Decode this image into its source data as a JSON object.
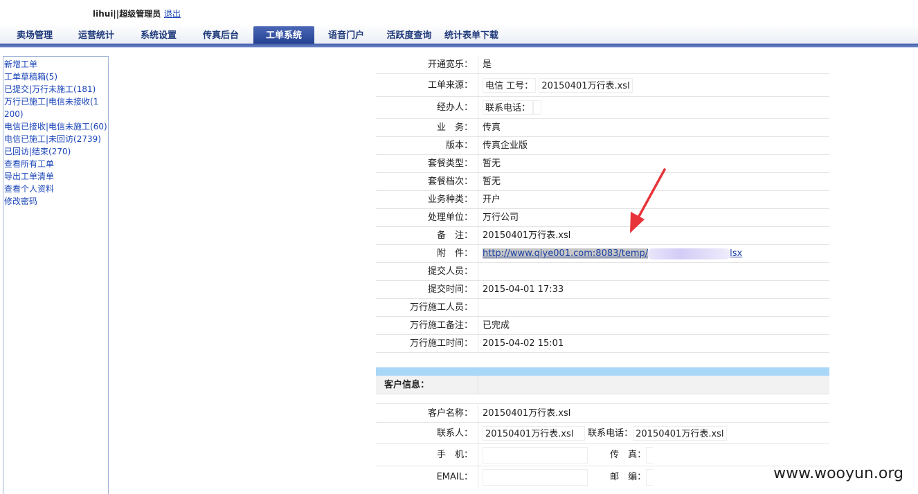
{
  "header": {
    "user": "lihui||超级管理员",
    "logout": "退出"
  },
  "nav": {
    "tabs": [
      {
        "label": "卖场管理"
      },
      {
        "label": "运营统计"
      },
      {
        "label": "系统设置"
      },
      {
        "label": "传真后台"
      },
      {
        "label": "工单系统",
        "active": true
      },
      {
        "label": "语音门户"
      },
      {
        "label": "活跃度查询"
      },
      {
        "label": "统计表单下载"
      }
    ]
  },
  "sidebar": {
    "items": [
      {
        "label": "新增工单"
      },
      {
        "label": "工单草稿箱(5)"
      },
      {
        "label": "已提交|万行未施工(181)"
      },
      {
        "label": "万行已施工|电信未接收(1200)"
      },
      {
        "label": "电信已接收|电信未施工(60)"
      },
      {
        "label": "电信已施工|未回访(2739)"
      },
      {
        "label": "已回访|结束(270)"
      },
      {
        "label": "查看所有工单"
      },
      {
        "label": "导出工单清单"
      },
      {
        "label": "查看个人资料"
      },
      {
        "label": "修改密码"
      }
    ]
  },
  "order": {
    "kaitong": {
      "label": "开通宽乐：",
      "value": "是"
    },
    "source": {
      "label": "工单来源：",
      "carrier": "电信",
      "gonghao_label": "工号：",
      "gonghao": "20150401万行表.xsl"
    },
    "handler": {
      "label": "经办人：",
      "phone_label": "联系电话：",
      "phone": ""
    },
    "business": {
      "label": "业　务：",
      "value": "传真"
    },
    "version": {
      "label": "版本：",
      "value": "传真企业版"
    },
    "pkg_type": {
      "label": "套餐类型：",
      "value": "暂无"
    },
    "pkg_level": {
      "label": "套餐档次：",
      "value": "暂无"
    },
    "biz_kind": {
      "label": "业务种类：",
      "value": "开户"
    },
    "unit": {
      "label": "处理单位：",
      "value": "万行公司"
    },
    "remark": {
      "label": "备　注：",
      "value": "20150401万行表.xsl"
    },
    "attach": {
      "label": "附　件：",
      "url_visible": "http://www.qiye001.com:8083/temp/",
      "url_tail": "lsx"
    },
    "submitter": {
      "label": "提交人员：",
      "value": ""
    },
    "submit_time": {
      "label": "提交时间：",
      "value": "2015-04-01 17:33"
    },
    "wh_worker": {
      "label": "万行施工人员：",
      "value": ""
    },
    "wh_remark": {
      "label": "万行施工备注：",
      "value": "已完成"
    },
    "wh_time": {
      "label": "万行施工时间：",
      "value": "2015-04-02 15:01"
    }
  },
  "customer": {
    "section_title": "客户信息：",
    "name": {
      "label": "客户名称：",
      "value": "20150401万行表.xsl"
    },
    "contact": {
      "label": "联系人：",
      "value": "20150401万行表.xsl",
      "phone_label": "联系电话：",
      "phone": "20150401万行表.xsl"
    },
    "mobile": {
      "label": "手　机：",
      "value": "",
      "fax_label": "传　真：",
      "fax": ""
    },
    "email": {
      "label": "EMAIL：",
      "value": "",
      "zip_label": "邮　编：",
      "zip": ""
    }
  },
  "watermark": "www.wooyun.org",
  "colors": {
    "accent": "#2b4799",
    "link": "#1a44b8",
    "section_bar": "#a9d7f8",
    "arrow": "#e8333a"
  }
}
